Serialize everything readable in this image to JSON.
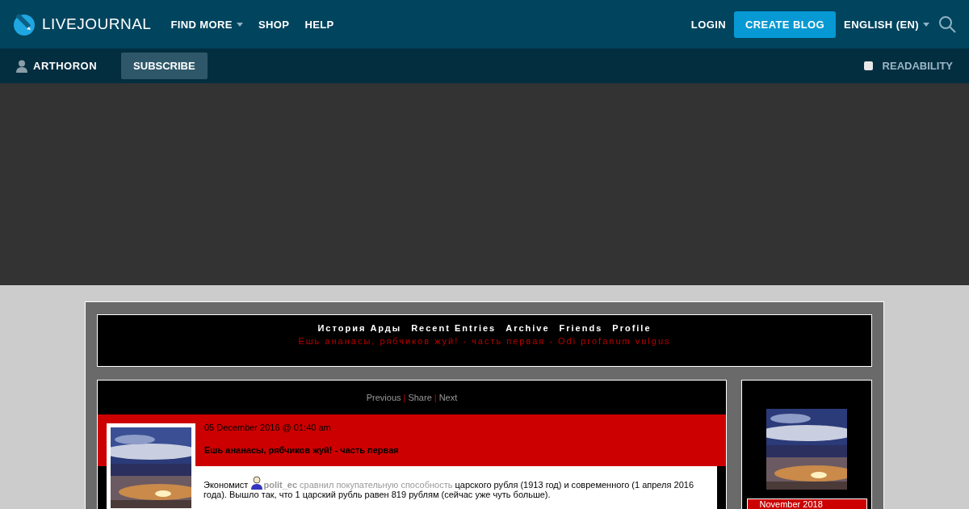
{
  "topbar": {
    "logo": "LIVEJOURNAL",
    "nav": [
      {
        "label": "FIND MORE",
        "dropdown": true
      },
      {
        "label": "SHOP",
        "dropdown": false
      },
      {
        "label": "HELP",
        "dropdown": false
      }
    ],
    "login": "LOGIN",
    "create_blog": "CREATE BLOG",
    "language": "ENGLISH (EN)"
  },
  "subbar": {
    "user": "ARTHORON",
    "subscribe": "SUBSCRIBE",
    "readability": {
      "label": "READABILITY",
      "checked": false
    }
  },
  "journal": {
    "links": [
      "История Арды",
      "Recent Entries",
      "Archive",
      "Friends",
      "Profile"
    ],
    "subtitle": "Ешь ананасы, рябчиков жуй! - часть первая - Odi profanum vulgus"
  },
  "entry": {
    "nav": [
      {
        "label": "Previous"
      },
      {
        "label": "Share"
      },
      {
        "label": "Next"
      }
    ],
    "separators": [
      "|",
      "|"
    ],
    "date": "05 December 2016 @ 01:40 am",
    "title": "Ешь ананасы, рябчиков жуй! - часть первая",
    "body": [
      {
        "kind": "text",
        "text": "Экономист "
      },
      {
        "kind": "user",
        "text": "polit_ec"
      },
      {
        "kind": "link",
        "text": " сравнил покупательную способность"
      },
      {
        "kind": "text",
        "text": " царского рубля (1913 год) и современного (1 апреля 2016 года). Вышло так, что 1 царский рубль равен 819 рублям (сейчас уже чуть больше)."
      }
    ]
  },
  "sidebar": {
    "calendar_title": "November 2018"
  }
}
